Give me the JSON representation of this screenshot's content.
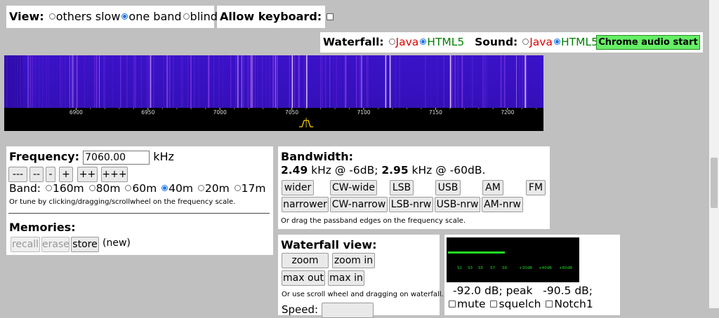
{
  "view": {
    "label": "View:",
    "options": [
      "others slow",
      "one band",
      "blind"
    ],
    "selected": 1
  },
  "keyboard": {
    "label": "Allow keyboard:"
  },
  "waterfall_toggle": {
    "label": "Waterfall:",
    "java": "Java",
    "html5": "HTML5"
  },
  "sound_toggle": {
    "label": "Sound:",
    "java": "Java",
    "html5": "HTML5"
  },
  "chrome_audio_button": "Chrome audio start",
  "scale": {
    "ticks": [
      "6900",
      "6950",
      "7000",
      "7050",
      "7100",
      "7150",
      "7200"
    ],
    "range_khz": [
      6850,
      7225
    ],
    "tuned_khz": 7060
  },
  "frequency": {
    "label": "Frequency:",
    "value": "7060.00",
    "unit": "kHz",
    "step_buttons": [
      "---",
      "--",
      "-",
      "+",
      "++",
      "+++"
    ],
    "band_label": "Band:",
    "bands": [
      "160m",
      "80m",
      "60m",
      "40m",
      "20m",
      "17m"
    ],
    "band_selected": 3,
    "hint": "Or tune by clicking/dragging/scrollwheel on the frequency scale."
  },
  "memories": {
    "label": "Memories:",
    "recall": "recall",
    "erase": "erase",
    "store": "store",
    "status": "(new)"
  },
  "bandwidth": {
    "label": "Bandwidth:",
    "bw6": "2.49",
    "bw6_text": " kHz @ -6dB; ",
    "bw60": "2.95",
    "bw60_text": " kHz @ -60dB.",
    "buttons_row1": [
      "wider",
      "CW-wide",
      "LSB",
      "USB",
      "AM",
      "FM"
    ],
    "buttons_row2": [
      "narrower",
      "CW-narrow",
      "LSB-nrw",
      "USB-nrw",
      "AM-nrw"
    ],
    "hint": "Or drag the passband edges on the frequency scale."
  },
  "waterfall_view": {
    "label": "Waterfall view:",
    "zoom_out": "zoom out",
    "zoom_in": "zoom in",
    "max_out": "max out",
    "max_in": "max in",
    "hint": "Or use scroll wheel and dragging on waterfall.",
    "speed_label": "Speed:"
  },
  "smeter": {
    "labels": [
      "S1",
      "S3",
      "S5",
      "S7",
      "S9",
      "+20dB",
      "+40dB",
      "+60dB"
    ],
    "level_fraction": 0.44,
    "readout": "-92.0 dB; peak   -90.5 dB;",
    "mute": "mute",
    "squelch": "squelch",
    "notch": "Notch1"
  },
  "colors": {
    "waterfall_bg": "#3a10c8",
    "meter_green": "#22dd22",
    "chrome_button": "#66ee66"
  }
}
